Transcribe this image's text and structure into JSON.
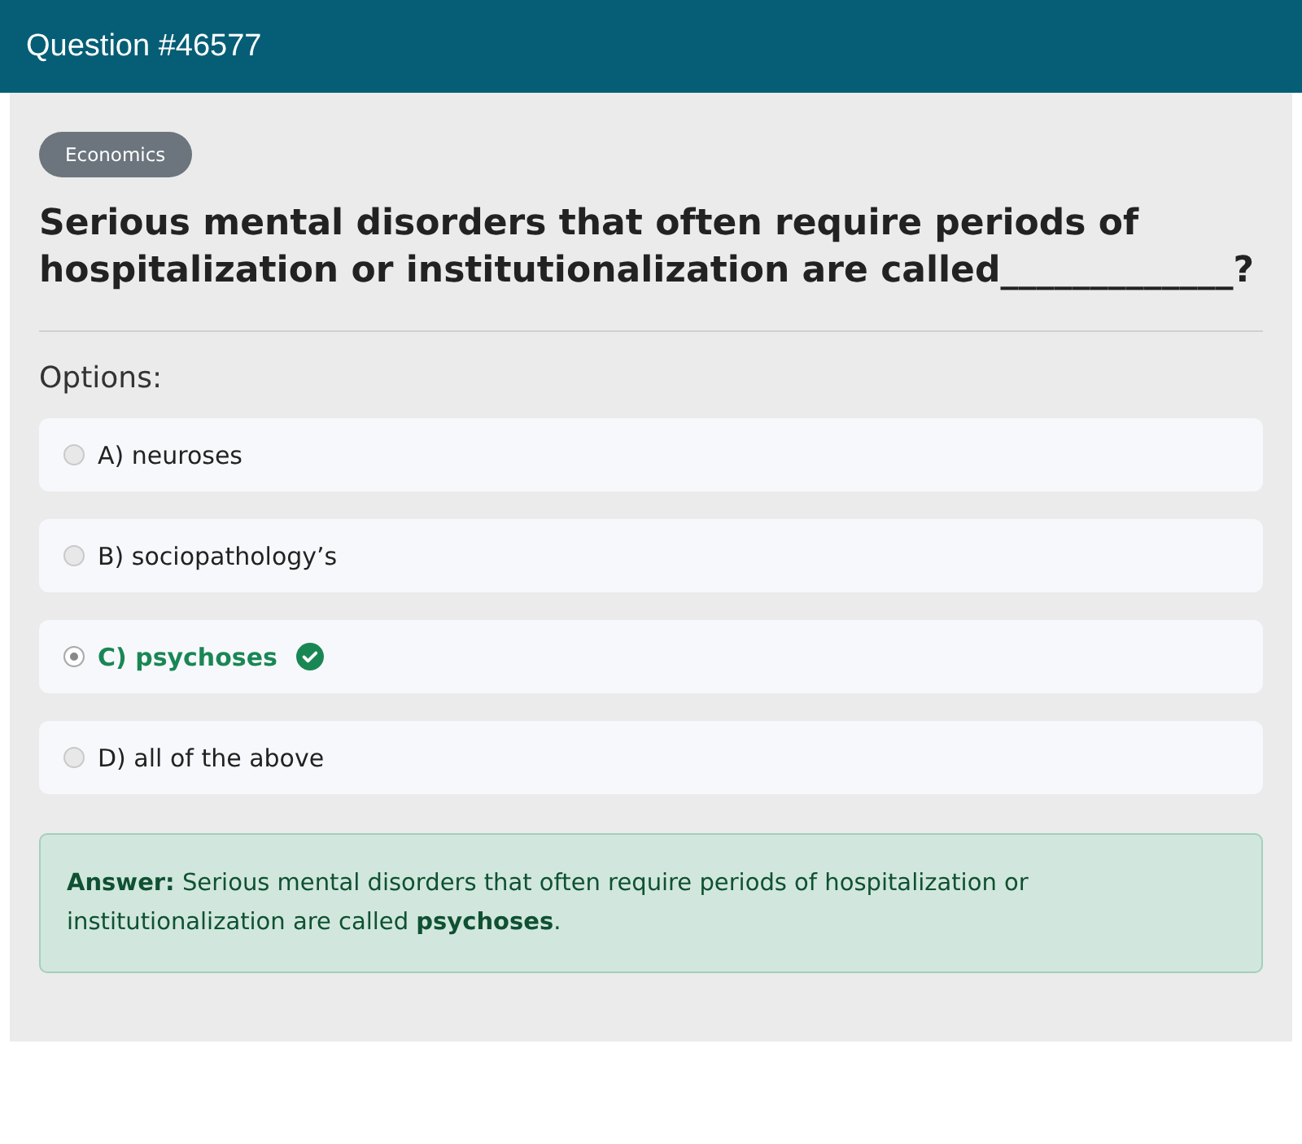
{
  "header": {
    "title": "Question #46577"
  },
  "category": "Economics",
  "question": "Serious mental disorders that often require periods of hospitalization or institutionalization are called_____________?",
  "options_label": "Options:",
  "options": [
    {
      "label": "A) neuroses",
      "selected": false,
      "correct": false
    },
    {
      "label": "B) sociopathology’s",
      "selected": false,
      "correct": false
    },
    {
      "label": "C) psychoses",
      "selected": true,
      "correct": true
    },
    {
      "label": "D) all of the above",
      "selected": false,
      "correct": false
    }
  ],
  "answer": "**Answer:** Serious mental disorders that often require periods of hospitalization or institutionalization are called **psychoses**."
}
